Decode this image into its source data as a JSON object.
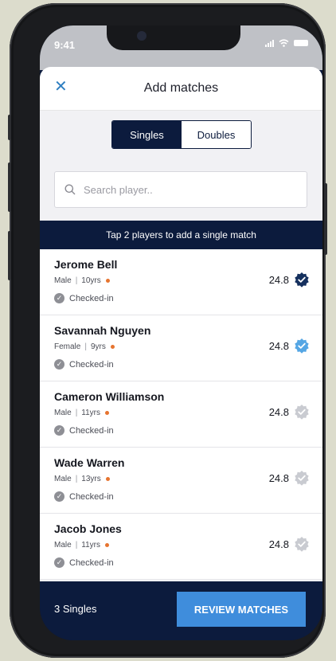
{
  "status_bar": {
    "time": "9:41"
  },
  "header": {
    "title": "Add matches"
  },
  "segmented": {
    "singles": "Singles",
    "doubles": "Doubles",
    "selected": "Singles"
  },
  "search": {
    "placeholder": "Search player.."
  },
  "banner": {
    "text": "Tap 2 players to add a single match"
  },
  "players": [
    {
      "name": "Jerome Bell",
      "gender": "Male",
      "age": "10yrs",
      "status": "Checked-in",
      "rating": "24.8",
      "badge_color": "#15305e"
    },
    {
      "name": "Savannah Nguyen",
      "gender": "Female",
      "age": "9yrs",
      "status": "Checked-in",
      "rating": "24.8",
      "badge_color": "#55a6e4"
    },
    {
      "name": "Cameron Williamson",
      "gender": "Male",
      "age": "11yrs",
      "status": "Checked-in",
      "rating": "24.8",
      "badge_color": "#c9cbd1"
    },
    {
      "name": "Wade Warren",
      "gender": "Male",
      "age": "13yrs",
      "status": "Checked-in",
      "rating": "24.8",
      "badge_color": "#c9cbd1"
    },
    {
      "name": "Jacob Jones",
      "gender": "Male",
      "age": "11yrs",
      "status": "Checked-in",
      "rating": "24.8",
      "badge_color": "#c9cbd1"
    }
  ],
  "footer": {
    "count": "3 Singles",
    "review_button": "REVIEW MATCHES"
  },
  "colors": {
    "navy": "#0c1b3d",
    "accent_blue": "#3f8ddc",
    "dot_orange": "#e6742f"
  }
}
